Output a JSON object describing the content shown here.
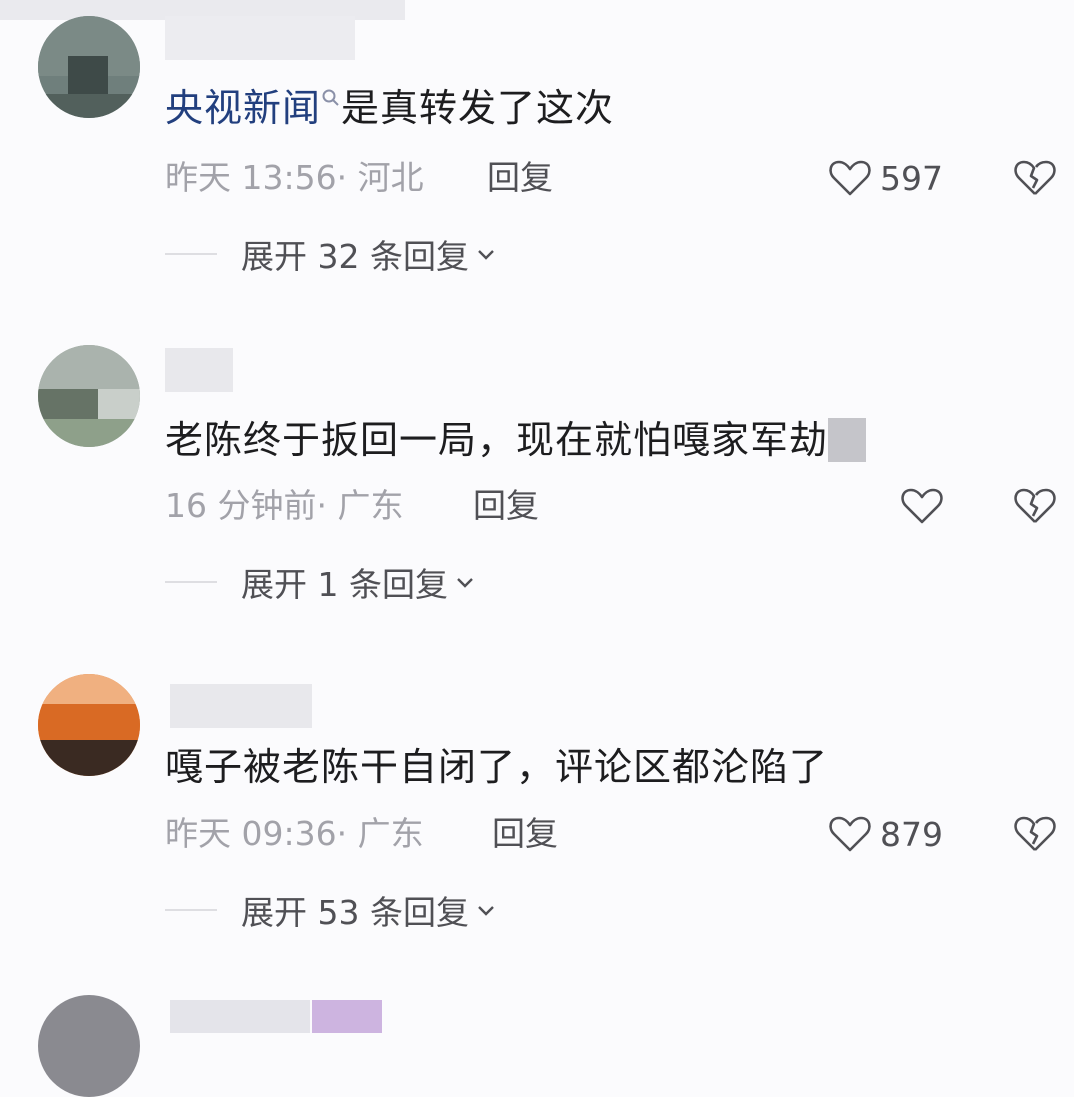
{
  "comments": [
    {
      "mention": "央视新闻",
      "text": "是真转发了这次",
      "time": "昨天 13:56",
      "location": "· 河北",
      "reply_label": "回复",
      "likes": "597",
      "expand_label": "展开 32 条回复"
    },
    {
      "text": "老陈终于扳回一局，现在就怕嘎家军劫",
      "time": "16 分钟前",
      "location": "· 广东",
      "reply_label": "回复",
      "likes": "",
      "expand_label": "展开 1 条回复"
    },
    {
      "text": "嘎子被老陈干自闭了，评论区都沦陷了",
      "time": "昨天 09:36",
      "location": "· 广东",
      "reply_label": "回复",
      "likes": "879",
      "expand_label": "展开 53 条回复"
    }
  ],
  "icons": {
    "like": "heart-outline-icon",
    "dislike": "broken-heart-icon",
    "expand": "chevron-down-icon",
    "mention": "search-icon"
  },
  "colors": {
    "background": "#fbfbfd",
    "text": "#1d1d1f",
    "mention": "#223f7e",
    "meta": "#a2a2a9",
    "action": "#505055"
  }
}
